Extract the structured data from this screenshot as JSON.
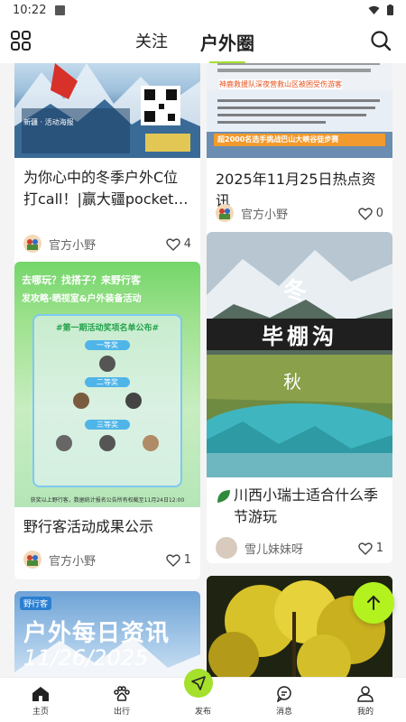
{
  "status_bar": {
    "time": "10:22"
  },
  "header": {
    "tabs": [
      {
        "label": "关注",
        "active": false
      },
      {
        "label": "户外圈",
        "active": true
      }
    ],
    "accent_color": "#a4e02c"
  },
  "feed": {
    "cards": [
      {
        "title": "为你心中的冬季户外C位打call！|赢大疆pocket…",
        "author": "官方小野",
        "likes": "4",
        "cover_text": "新疆 · 活动海报"
      },
      {
        "title": "2025年11月25日热点资讯",
        "author": "官方小野",
        "likes": "0",
        "cover_headline": "神鹿救援队深夜营救山区被困受伤游客",
        "cover_note": "超2000名选手挑战巴山大峡谷徒步赛"
      },
      {
        "title": "野行客活动成果公示",
        "author": "官方小野",
        "likes": "1",
        "cover_header": "去哪玩？找搭子？来野行客",
        "cover_sub": "发攻略·晒视室&户外装备活动",
        "cover_list_title": "#第一期活动奖项名单公布#",
        "prize_1": "一等奖",
        "prize_2": "二等奖",
        "prize_3": "三等奖",
        "footer": "获奖以上野行客，数据统计报名公告所有权截至11月24日12:00"
      },
      {
        "title": "川西小瑞士适合什么季节游玩",
        "author": "雪儿妹妹呀",
        "likes": "1",
        "cover_char_top": "冬",
        "cover_char_name": "毕棚沟",
        "cover_char_bottom": "秋"
      },
      {
        "cover_logo": "野行客",
        "cover_title": "户外每日资讯",
        "cover_date": "11/26/2025"
      },
      {
        "cover_desc": "golden autumn trees"
      }
    ]
  },
  "bottom_nav": {
    "items": [
      {
        "label": "主页"
      },
      {
        "label": "出行"
      },
      {
        "label": "发布"
      },
      {
        "label": "消息"
      },
      {
        "label": "我的"
      }
    ]
  }
}
